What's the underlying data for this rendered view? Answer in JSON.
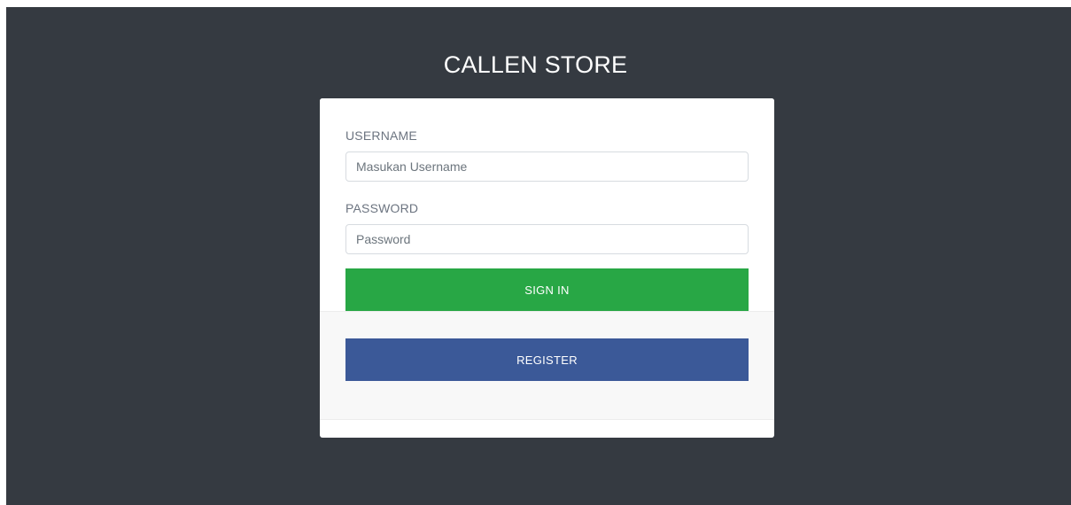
{
  "brand": {
    "title": "CALLEN STORE"
  },
  "form": {
    "username_label": "USERNAME",
    "username_placeholder": "Masukan Username",
    "username_value": "",
    "password_label": "PASSWORD",
    "password_placeholder": "Password",
    "password_value": "",
    "signin_label": "SIGN IN",
    "register_label": "REGISTER"
  },
  "colors": {
    "background": "#353a41",
    "signin": "#28a745",
    "register": "#3b5998"
  }
}
